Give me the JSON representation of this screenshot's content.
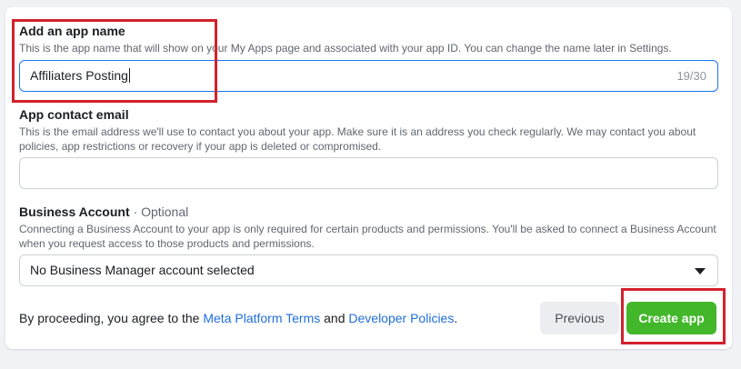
{
  "app_name": {
    "label": "Add an app name",
    "help": "This is the app name that will show on your My Apps page and associated with your app ID. You can change the name later in Settings.",
    "value": "Affiliaters Posting",
    "counter": "19/30"
  },
  "contact_email": {
    "label": "App contact email",
    "help": "This is the email address we'll use to contact you about your app. Make sure it is an address you check regularly. We may contact you about policies, app restrictions or recovery if your app is deleted or compromised.",
    "value": ""
  },
  "business_account": {
    "label": "Business Account",
    "optional": " · Optional",
    "help": "Connecting a Business Account to your app is only required for certain products and permissions. You'll be asked to connect a Business Account when you request access to those products and permissions.",
    "selected": "No Business Manager account selected"
  },
  "footer": {
    "text_before": "By proceeding, you agree to the ",
    "terms_link": "Meta Platform Terms",
    "text_between": " and ",
    "policies_link": "Developer Policies",
    "text_after": "."
  },
  "buttons": {
    "previous": "Previous",
    "create": "Create app"
  },
  "colors": {
    "accent_blue": "#1877f2",
    "link": "#216fdb",
    "create_green": "#42b72a",
    "annotation_red": "#d4202c"
  }
}
